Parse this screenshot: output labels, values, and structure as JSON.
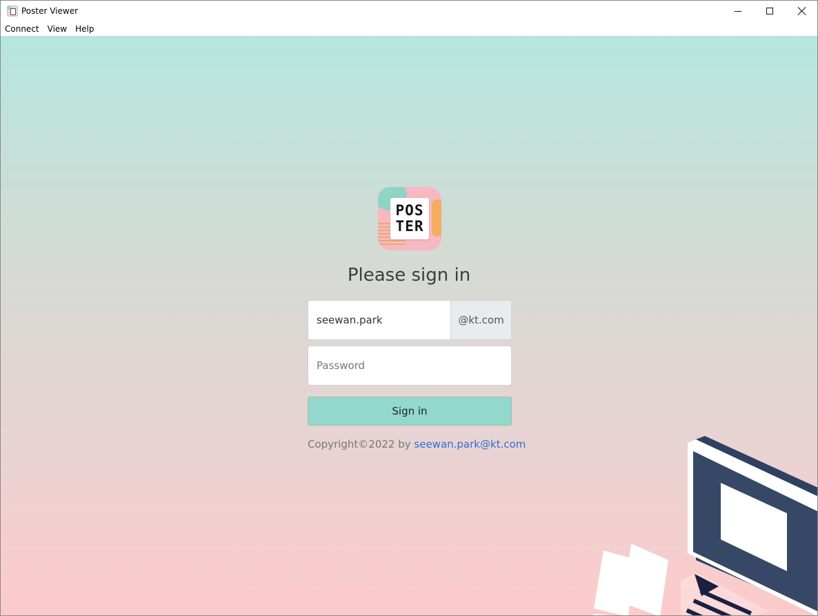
{
  "window": {
    "title": "Poster Viewer"
  },
  "menu": {
    "items": [
      "Connect",
      "View",
      "Help"
    ]
  },
  "logo": {
    "line1": "POS",
    "line2": "TER"
  },
  "login": {
    "heading": "Please sign in",
    "username_value": "seewan.park",
    "domain_suffix": "@kt.com",
    "password_placeholder": "Password",
    "signin_label": "Sign in",
    "copyright_prefix": "Copyright©2022 by ",
    "copyright_email": "seewan.park@kt.com"
  },
  "colors": {
    "accent": "#93d8cc",
    "link": "#2f6fd0",
    "gradient_top": "#b5e6de",
    "gradient_bottom": "#fdcacb",
    "laptop": "#364866"
  }
}
